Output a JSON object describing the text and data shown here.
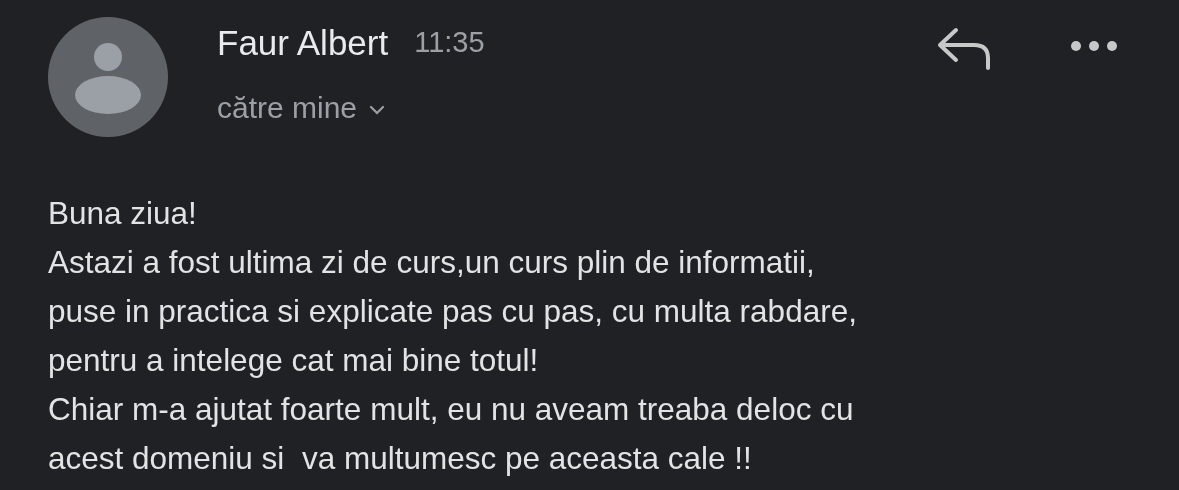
{
  "sender": {
    "name": "Faur Albert",
    "time": "11:35",
    "recipient": "către mine"
  },
  "body_lines": [
    "Buna ziua!",
    "Astazi a fost ultima zi de curs,un curs plin de informatii,",
    "puse in practica si explicate pas cu pas, cu multa rabdare,",
    "pentru a intelege cat mai bine totul!",
    "Chiar m-a ajutat foarte mult, eu nu aveam treaba deloc cu",
    "acest domeniu si  va multumesc pe aceasta cale !!"
  ]
}
